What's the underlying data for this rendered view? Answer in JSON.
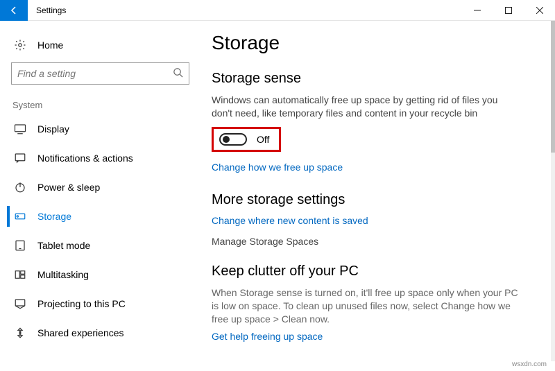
{
  "titlebar": {
    "title": "Settings"
  },
  "sidebar": {
    "home": "Home",
    "search_placeholder": "Find a setting",
    "section": "System",
    "items": [
      {
        "label": "Display"
      },
      {
        "label": "Notifications & actions"
      },
      {
        "label": "Power & sleep"
      },
      {
        "label": "Storage"
      },
      {
        "label": "Tablet mode"
      },
      {
        "label": "Multitasking"
      },
      {
        "label": "Projecting to this PC"
      },
      {
        "label": "Shared experiences"
      }
    ]
  },
  "main": {
    "page_title": "Storage",
    "sense_heading": "Storage sense",
    "sense_desc": "Windows can automatically free up space by getting rid of files you don't need, like temporary files and content in your recycle bin",
    "toggle_state": "Off",
    "link_change_free": "Change how we free up space",
    "more_heading": "More storage settings",
    "link_change_saved": "Change where new content is saved",
    "manage_spaces": "Manage Storage Spaces",
    "clutter_heading": "Keep clutter off your PC",
    "clutter_desc": "When Storage sense is turned on, it'll free up space only when your PC is low on space. To clean up unused files now, select Change how we free up space > Clean now.",
    "link_get_help": "Get help freeing up space"
  },
  "watermark": "wsxdn.com"
}
